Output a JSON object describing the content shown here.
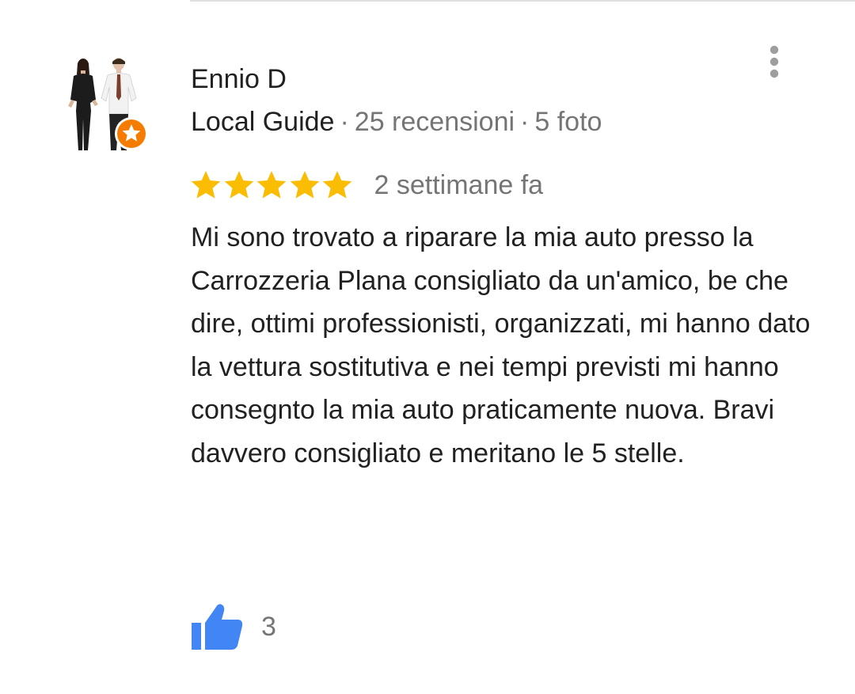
{
  "review": {
    "author": {
      "name": "Ennio D",
      "badge": "Local Guide",
      "reviews_count": "25 recensioni",
      "photos_count": "5 foto",
      "separator": "·"
    },
    "rating": 5,
    "rating_max": 5,
    "date": "2 settimane fa",
    "text": "Mi sono trovato a riparare la mia auto presso la Carrozzeria Plana consigliato da un'amico, be che dire, ottimi professionisti, organizzati, mi hanno dato la vettura sostitutiva e nei tempi previsti mi hanno consegnto la mia auto praticamente nuova. Bravi davvero consigliato e meritano le 5 stelle.",
    "likes": "3"
  },
  "icons": {
    "avatar": "avatar-two-people",
    "local_guide_badge": "local-guide-star-badge-icon",
    "menu": "more-vert-icon",
    "star": "star-icon",
    "like": "thumbs-up-icon"
  },
  "colors": {
    "star": "#FBBC04",
    "like": "#4285F4",
    "badge": "#F57C00",
    "text_primary": "#212121",
    "text_secondary": "#757575",
    "menu_dots": "#9E9E9E"
  }
}
